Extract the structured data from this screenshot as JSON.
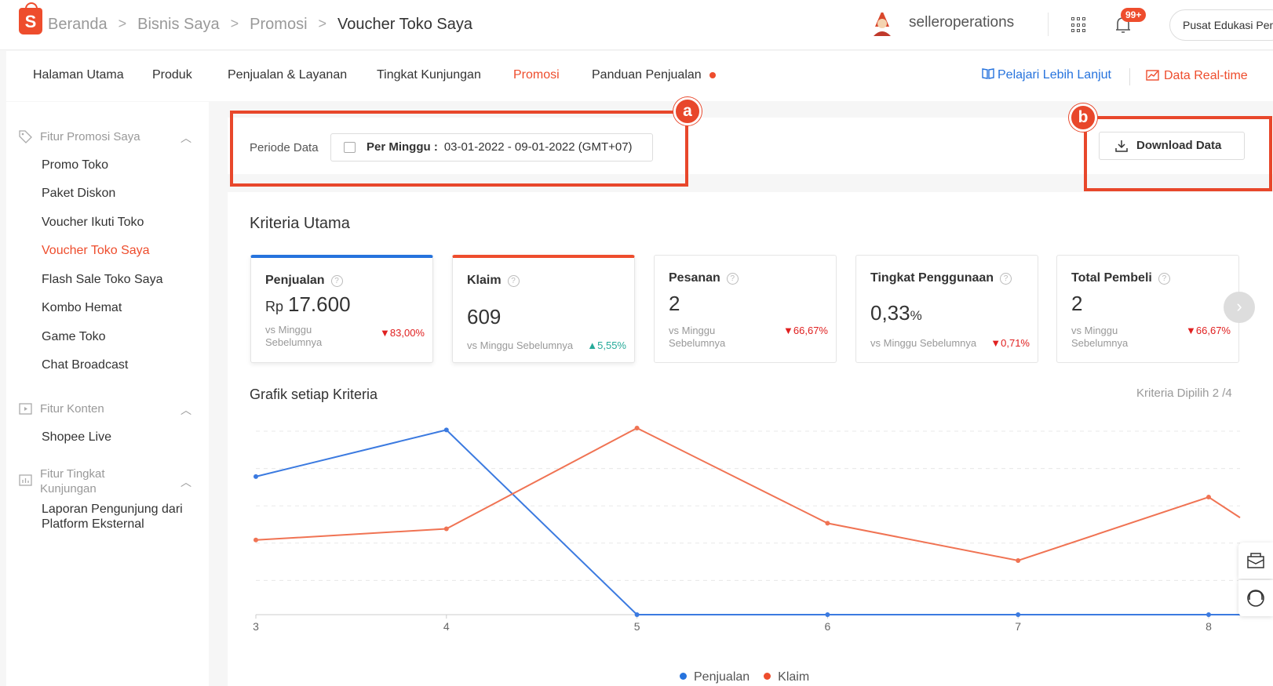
{
  "breadcrumb": [
    "Beranda",
    "Bisnis Saya",
    "Promosi",
    "Voucher Toko Saya"
  ],
  "logo_letter": "S",
  "header": {
    "username": "selleroperations",
    "notification_badge": "99+",
    "edu_button": "Pusat Edukasi Penjual"
  },
  "nav": {
    "items": [
      "Halaman Utama",
      "Produk",
      "Penjualan & Layanan",
      "Tingkat Kunjungan",
      "Promosi",
      "Panduan Penjualan"
    ],
    "active": "Promosi",
    "learn_more": "Pelajari Lebih Lanjut",
    "realtime": "Data Real-time"
  },
  "sidebar": {
    "group1": "Fitur Promosi Saya",
    "group1_items": [
      "Promo Toko",
      "Paket Diskon",
      "Voucher Ikuti Toko",
      "Voucher Toko Saya",
      "Flash Sale Toko Saya",
      "Kombo Hemat",
      "Game Toko",
      "Chat Broadcast"
    ],
    "active": "Voucher Toko Saya",
    "group2": "Fitur Konten",
    "group2_items": [
      "Shopee Live"
    ],
    "group3": "Fitur Tingkat Kunjungan",
    "group3_items": [
      "Laporan Pengunjung dari Platform Eksternal"
    ]
  },
  "period": {
    "label": "Periode Data",
    "type": "Per Minggu :",
    "range": "03-01-2022 - 09-01-2022 (GMT+07)"
  },
  "download_label": "Download Data",
  "annotations": {
    "a": "a",
    "b": "b"
  },
  "main": {
    "section_title": "Kriteria Utama",
    "chart_title": "Grafik setiap Kriteria",
    "criteria_selected": "Kriteria Dipilih 2 /4"
  },
  "metrics": [
    {
      "title": "Penjualan",
      "prefix": "Rp",
      "value": "17.600",
      "compare": "vs Minggu Sebelumnya",
      "change": "▼83,00%",
      "dir": "down",
      "selected": "blue"
    },
    {
      "title": "Klaim",
      "prefix": "",
      "value": "609",
      "compare": "vs Minggu Sebelumnya",
      "change": "▲5,55%",
      "dir": "up",
      "selected": "red"
    },
    {
      "title": "Pesanan",
      "prefix": "",
      "value": "2",
      "compare": "vs Minggu Sebelumnya",
      "change": "▼66,67%",
      "dir": "down",
      "selected": ""
    },
    {
      "title": "Tingkat Penggunaan",
      "prefix": "",
      "value": "0,33",
      "suffix": "%",
      "compare": "vs Minggu Sebelumnya",
      "change": "▼0,71%",
      "dir": "down",
      "selected": ""
    },
    {
      "title": "Total Pembeli",
      "prefix": "",
      "value": "2",
      "compare": "vs Minggu Sebelumnya",
      "change": "▼66,67%",
      "dir": "down",
      "selected": ""
    }
  ],
  "colors": {
    "accent": "#ee4d2d",
    "blue": "#2673dd",
    "highlight": "#e8472b"
  },
  "chart_data": {
    "type": "line",
    "x": [
      3,
      4,
      5,
      6,
      7,
      8
    ],
    "series": [
      {
        "name": "Penjualan",
        "color": "#3b7ae0",
        "values": [
          0.74,
          0.99,
          0.0,
          0.0,
          0.0,
          0.0
        ]
      },
      {
        "name": "Klaim",
        "color": "#f07353",
        "values": [
          0.4,
          0.46,
          1.0,
          0.49,
          0.29,
          0.63
        ]
      }
    ],
    "grid": true,
    "legend": "bottom-center"
  }
}
